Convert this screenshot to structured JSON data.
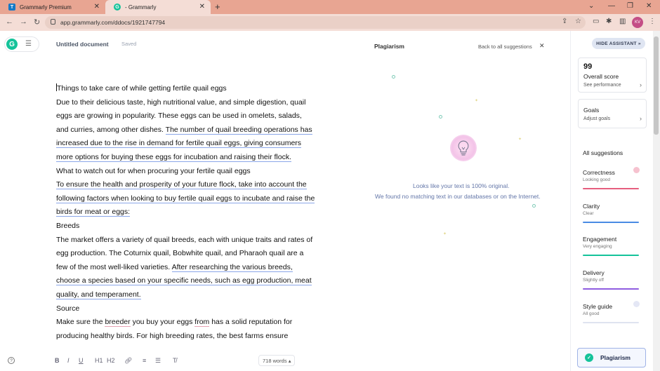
{
  "browser": {
    "tabs": [
      {
        "label": "Grammarly Premium",
        "icon_letter": "T",
        "icon_color": "#1479c6"
      },
      {
        "label": "- Grammarly",
        "icon_letter": "G",
        "icon_color": "#15c39a"
      }
    ],
    "url": "app.grammarly.com/ddocs/1921747794",
    "profile_initials": "KV"
  },
  "app": {
    "logo": "G",
    "doc_title": "Untitled document",
    "save_status": "Saved"
  },
  "editor": {
    "title_line": "Things to take care of while getting fertile quail eggs",
    "para1_plain": "Due to their delicious taste, high nutritional value, and simple digestion, quail eggs are growing in popularity. These eggs can be used in omelets, salads, and curries, among other dishes. ",
    "para1_underlined": "The number of quail breeding operations has increased due to the rise in demand for fertile quail eggs, giving consumers more options for buying these eggs for incubation and raising their flock.",
    "heading2": "What to watch out for when procuring your fertile quail eggs",
    "para2_underlined": "To ensure the health and prosperity of your future flock, take into account the following factors when looking to buy fertile quail eggs to incubate and raise the birds for meat or eggs:",
    "heading3": "Breeds",
    "para3_plain": "The market offers a variety of quail breeds, each with unique traits and rates of egg production. The Coturnix quail, Bobwhite quail, and Pharaoh quail are a few of the most well-liked varieties. ",
    "para3_underlined": "After researching the various breeds, choose a species based on your specific needs, such as egg production, meat quality, and temperament.",
    "heading4": "Source",
    "para4_a": "Make sure the ",
    "para4_b": "breeder",
    "para4_c": " you buy your eggs ",
    "para4_d": "from",
    "para4_e": " has a solid reputation for producing healthy birds. For high breeding rates, the best farms ensure"
  },
  "toolbar": {
    "bold": "B",
    "italic": "I",
    "underline": "U",
    "h1": "H1",
    "h2": "H2",
    "word_count": "718 words"
  },
  "plagiarism": {
    "title": "Plagiarism",
    "back_link": "Back to all suggestions",
    "msg1": "Looks like your text is 100% original.",
    "msg2": "We found no matching text in our databases or on the Internet."
  },
  "sidebar": {
    "hide_button": "HIDE ASSISTANT",
    "score": "99",
    "score_label": "Overall score",
    "score_link": "See performance",
    "goals_label": "Goals",
    "goals_link": "Adjust goals",
    "all_suggestions": "All suggestions",
    "categories": [
      {
        "name": "Correctness",
        "status": "Looking good",
        "color": "#e65e7e"
      },
      {
        "name": "Clarity",
        "status": "Clear",
        "color": "#4a8be4"
      },
      {
        "name": "Engagement",
        "status": "Very engaging",
        "color": "#15c39a"
      },
      {
        "name": "Delivery",
        "status": "Slightly off",
        "color": "#8f5ce0"
      },
      {
        "name": "Style guide",
        "status": "All good",
        "color": "#9aa2c8"
      }
    ],
    "plagiarism_button": "Plagiarism"
  }
}
